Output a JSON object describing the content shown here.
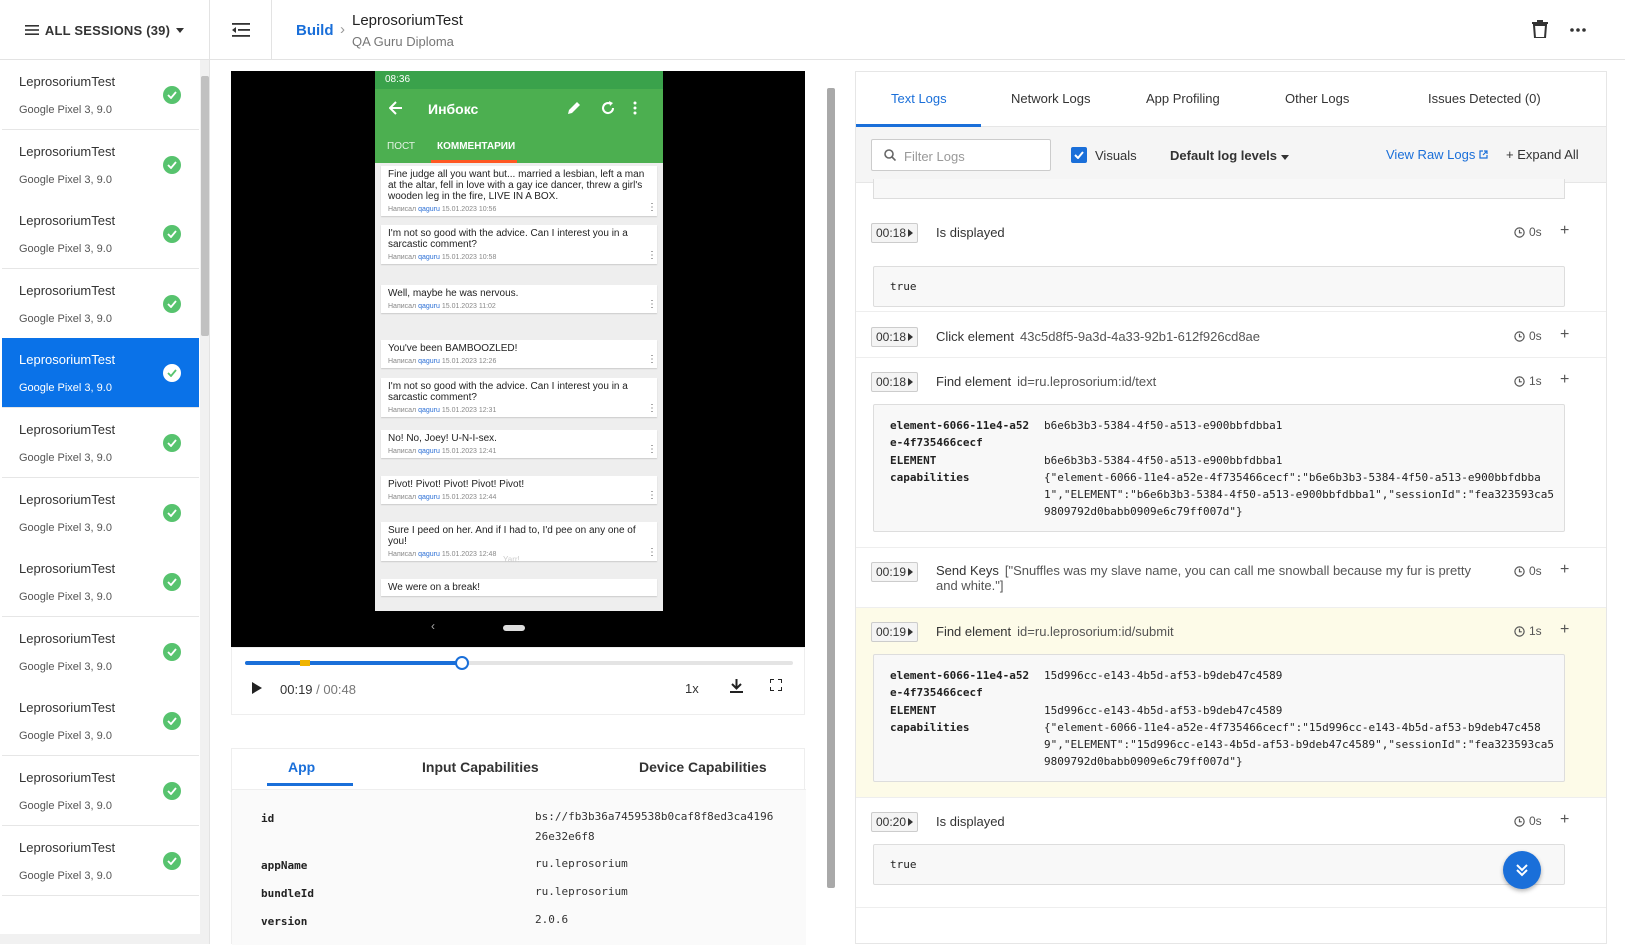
{
  "header": {
    "sessions_label": "ALL SESSIONS (39)",
    "breadcrumb_root": "Build",
    "session_title": "LeprosoriumTest",
    "project": "QA Guru Diploma"
  },
  "sidebar": {
    "items": [
      {
        "name": "LeprosoriumTest",
        "device": "Google Pixel 3, 9.0"
      },
      {
        "name": "LeprosoriumTest",
        "device": "Google Pixel 3, 9.0"
      },
      {
        "name": "LeprosoriumTest",
        "device": "Google Pixel 3, 9.0"
      },
      {
        "name": "LeprosoriumTest",
        "device": "Google Pixel 3, 9.0"
      },
      {
        "name": "LeprosoriumTest",
        "device": "Google Pixel 3, 9.0",
        "active": true
      },
      {
        "name": "LeprosoriumTest",
        "device": "Google Pixel 3, 9.0"
      },
      {
        "name": "LeprosoriumTest",
        "device": "Google Pixel 3, 9.0"
      },
      {
        "name": "LeprosoriumTest",
        "device": "Google Pixel 3, 9.0"
      },
      {
        "name": "LeprosoriumTest",
        "device": "Google Pixel 3, 9.0"
      },
      {
        "name": "LeprosoriumTest",
        "device": "Google Pixel 3, 9.0"
      },
      {
        "name": "LeprosoriumTest",
        "device": "Google Pixel 3, 9.0"
      },
      {
        "name": "LeprosoriumTest",
        "device": "Google Pixel 3, 9.0"
      }
    ]
  },
  "phone": {
    "time": "08:36",
    "title": "Инбокс",
    "tab_post": "ПОСТ",
    "tab_comments": "КОММЕНТАРИИ",
    "comments": [
      {
        "text": "Fine judge all you want but... married a lesbian, left a man at the altar, fell in love with a gay ice dancer, threw a girl's wooden leg in the fire, LIVE IN A BOX.",
        "prefix": "Написал",
        "author": "qaguru",
        "date": "15.01.2023 10:56"
      },
      {
        "text": "I'm not so good with the advice. Can I interest you in a sarcastic comment?",
        "prefix": "Написал",
        "author": "qaguru",
        "date": "15.01.2023 10:58"
      },
      {
        "text": "Well, maybe he was nervous.",
        "prefix": "Написал",
        "author": "qaguru",
        "date": "15.01.2023 11:02"
      },
      {
        "text": "You've been BAMBOOZLED!",
        "prefix": "Написал",
        "author": "qaguru",
        "date": "15.01.2023 12:26"
      },
      {
        "text": "I'm not so good with the advice. Can I interest you in a sarcastic comment?",
        "prefix": "Написал",
        "author": "qaguru",
        "date": "15.01.2023 12:31"
      },
      {
        "text": "No! No, Joey! U-N-I-sex.",
        "prefix": "Написал",
        "author": "qaguru",
        "date": "15.01.2023 12:41"
      },
      {
        "text": "Pivot! Pivot! Pivot! Pivot! Pivot!",
        "prefix": "Написал",
        "author": "qaguru",
        "date": "15.01.2023 12:44"
      },
      {
        "text": "Sure I peed on her. And if I had to, I'd pee on any one of you!",
        "prefix": "Написал",
        "author": "qaguru",
        "date": "15.01.2023 12:48"
      },
      {
        "text": "We were on a break!",
        "prefix": "",
        "author": "",
        "date": ""
      }
    ],
    "watermark": "Yarr!"
  },
  "player": {
    "current": "00:19",
    "total": "/ 00:48",
    "speed": "1x",
    "progress": 0.396
  },
  "caps": {
    "tabs": [
      "App",
      "Input Capabilities",
      "Device Capabilities"
    ],
    "rows": [
      {
        "k": "id",
        "v": "bs://fb3b36a7459538b0caf8f8ed3ca4196 26e32e6f8"
      },
      {
        "k": "appName",
        "v": "ru.leprosorium"
      },
      {
        "k": "bundleId",
        "v": "ru.leprosorium"
      },
      {
        "k": "version",
        "v": "2.0.6"
      }
    ]
  },
  "logs": {
    "tabs": [
      "Text Logs",
      "Network Logs",
      "App Profiling",
      "Other Logs",
      "Issues Detected (0)"
    ],
    "filter_placeholder": "Filter Logs",
    "visuals_label": "Visuals",
    "levels_label": "Default log levels",
    "raw_logs": "View Raw Logs",
    "expand_all": "+ Expand All",
    "entries": [
      {
        "time": "00:18",
        "action": "Is displayed",
        "detail": "",
        "duration": "0s",
        "result": "true"
      },
      {
        "time": "00:18",
        "action": "Click element",
        "detail": "43c5d8f5-9a3d-4a33-92b1-612f926cd8ae",
        "duration": "0s"
      },
      {
        "time": "00:18",
        "action": "Find element",
        "detail": "id=ru.leprosorium:id/text",
        "duration": "1s",
        "kv": [
          {
            "k": "element-6066-11e4-a52e-4f735466cecf",
            "v": "b6e6b3b3-5384-4f50-a513-e900bbfdbba1"
          },
          {
            "k": "ELEMENT",
            "v": "b6e6b3b3-5384-4f50-a513-e900bbfdbba1"
          },
          {
            "k": "capabilities",
            "v": "{\"element-6066-11e4-a52e-4f735466cecf\":\"b6e6b3b3-5384-4f50-a513-e900bbfdbba1\",\"ELEMENT\":\"b6e6b3b3-5384-4f50-a513-e900bbfdbba1\",\"sessionId\":\"fea323593ca59809792d0babb0909e6c79ff007d\"}"
          }
        ]
      },
      {
        "time": "00:19",
        "action": "Send Keys",
        "detail": "[\"Snuffles was my slave name, you can call me snowball because my fur is pretty and white.\"]",
        "duration": "0s"
      },
      {
        "time": "00:19",
        "action": "Find element",
        "detail": "id=ru.leprosorium:id/submit",
        "duration": "1s",
        "kv": [
          {
            "k": "element-6066-11e4-a52e-4f735466cecf",
            "v": "15d996cc-e143-4b5d-af53-b9deb47c4589"
          },
          {
            "k": "ELEMENT",
            "v": "15d996cc-e143-4b5d-af53-b9deb47c4589"
          },
          {
            "k": "capabilities",
            "v": "{\"element-6066-11e4-a52e-4f735466cecf\":\"15d996cc-e143-4b5d-af53-b9deb47c4589\",\"ELEMENT\":\"15d996cc-e143-4b5d-af53-b9deb47c4589\",\"sessionId\":\"fea323593ca59809792d0babb0909e6c79ff007d\"}"
          }
        ]
      },
      {
        "time": "00:20",
        "action": "Is displayed",
        "detail": "",
        "duration": "0s",
        "result": "true"
      }
    ]
  },
  "colors": {
    "accent": "#1a6fd9",
    "success": "#57c36e",
    "android_green": "#4caf50"
  }
}
